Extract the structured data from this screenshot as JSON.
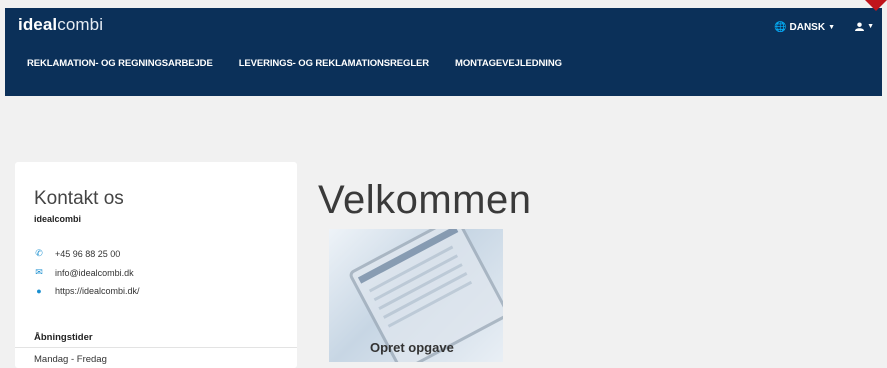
{
  "header": {
    "brand_bold": "ideal",
    "brand_light": "combi",
    "language": "DANSK",
    "nav": [
      "REKLAMATION- OG REGNINGSARBEJDE",
      "LEVERINGS- OG REKLAMATIONSREGLER",
      "MONTAGEVEJLEDNING"
    ]
  },
  "contact": {
    "title": "Kontakt os",
    "company": "idealcombi",
    "phone": "+45 96 88 25 00",
    "email": "info@idealcombi.dk",
    "website": "https://idealcombi.dk/",
    "hours_title": "Åbningstider",
    "hours_row": "Mandag - Fredag"
  },
  "main": {
    "welcome": "Velkommen",
    "tile_label": "Opret opgave"
  },
  "colors": {
    "header_bg": "#0b3059",
    "accent": "#1a8fd0",
    "corner": "#c0151c"
  }
}
